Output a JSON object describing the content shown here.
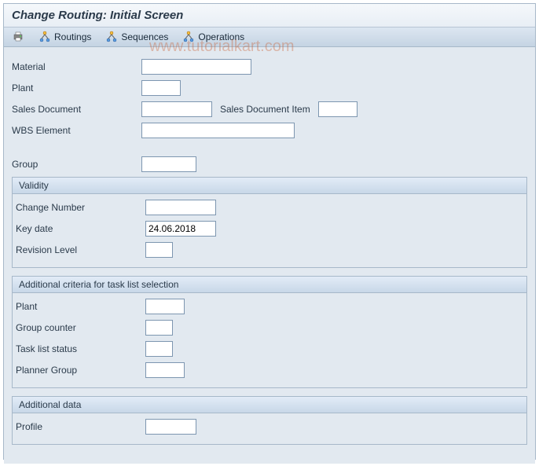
{
  "title": "Change Routing: Initial Screen",
  "watermark": "www.tutorialkart.com",
  "toolbar": {
    "routings": "Routings",
    "sequences": "Sequences",
    "operations": "Operations"
  },
  "fields": {
    "material": {
      "label": "Material",
      "value": ""
    },
    "plant": {
      "label": "Plant",
      "value": ""
    },
    "sales_document": {
      "label": "Sales Document",
      "value": ""
    },
    "sales_document_item": {
      "label": "Sales Document Item",
      "value": ""
    },
    "wbs_element": {
      "label": "WBS Element",
      "value": ""
    },
    "group": {
      "label": "Group",
      "value": ""
    }
  },
  "validity": {
    "title": "Validity",
    "change_number": {
      "label": "Change Number",
      "value": ""
    },
    "key_date": {
      "label": "Key date",
      "value": "24.06.2018"
    },
    "revision_level": {
      "label": "Revision Level",
      "value": ""
    }
  },
  "additional_criteria": {
    "title": "Additional criteria for task list selection",
    "plant": {
      "label": "Plant",
      "value": ""
    },
    "group_counter": {
      "label": "Group counter",
      "value": ""
    },
    "task_list_status": {
      "label": "Task list status",
      "value": ""
    },
    "planner_group": {
      "label": "Planner Group",
      "value": ""
    }
  },
  "additional_data": {
    "title": "Additional data",
    "profile": {
      "label": "Profile",
      "value": ""
    }
  }
}
